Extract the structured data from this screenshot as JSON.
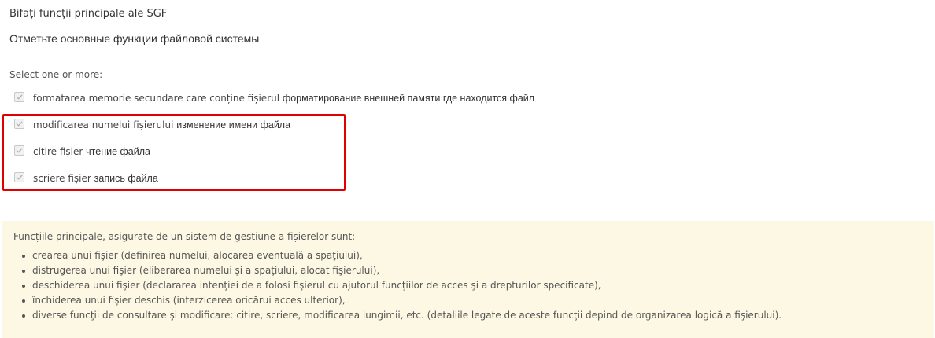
{
  "question": {
    "line_ro": "Bifați funcții principale ale SGF",
    "line_ru": "Отметьте основные функции файловой системы"
  },
  "prompt": "Select one or more:",
  "options": [
    {
      "text_ro": "formatarea memorie secundare care conține fișierul",
      "text_ru": "форматирование внешней памяти где находится файл",
      "checked": true
    },
    {
      "text_ro": "modificarea numelui fișierului",
      "text_ru": "изменение имени  файла",
      "checked": true
    },
    {
      "text_ro": "citire fișier",
      "text_ru": "чтение файла",
      "checked": true
    },
    {
      "text_ro": "scriere fișier",
      "text_ru": "запись файла",
      "checked": true
    }
  ],
  "feedback": {
    "intro": "Funcțiile principale, asigurate de un sistem de gestiune a fișierelor sunt:",
    "items": [
      "crearea unui fişier (definirea numelui, alocarea eventuală a spaţiului),",
      "distrugerea unui fişier (eliberarea numelui şi a spaţiului, alocat fişierului),",
      "deschiderea unui fişier (declararea intenţiei de a folosi fişierul cu ajutorul funcţiilor de acces şi a drepturilor specificate),",
      "închiderea unui fişier deschis (interzicerea oricărui acces ulterior),",
      "diverse funcţii de consultare şi modificare: citire, scriere, modificarea lungimii, etc. (detaliile legate de aceste funcţii depind de organizarea logică a fişierului)."
    ]
  },
  "colors": {
    "highlight": "#e00000",
    "feedback_bg": "#fcf8e3"
  }
}
